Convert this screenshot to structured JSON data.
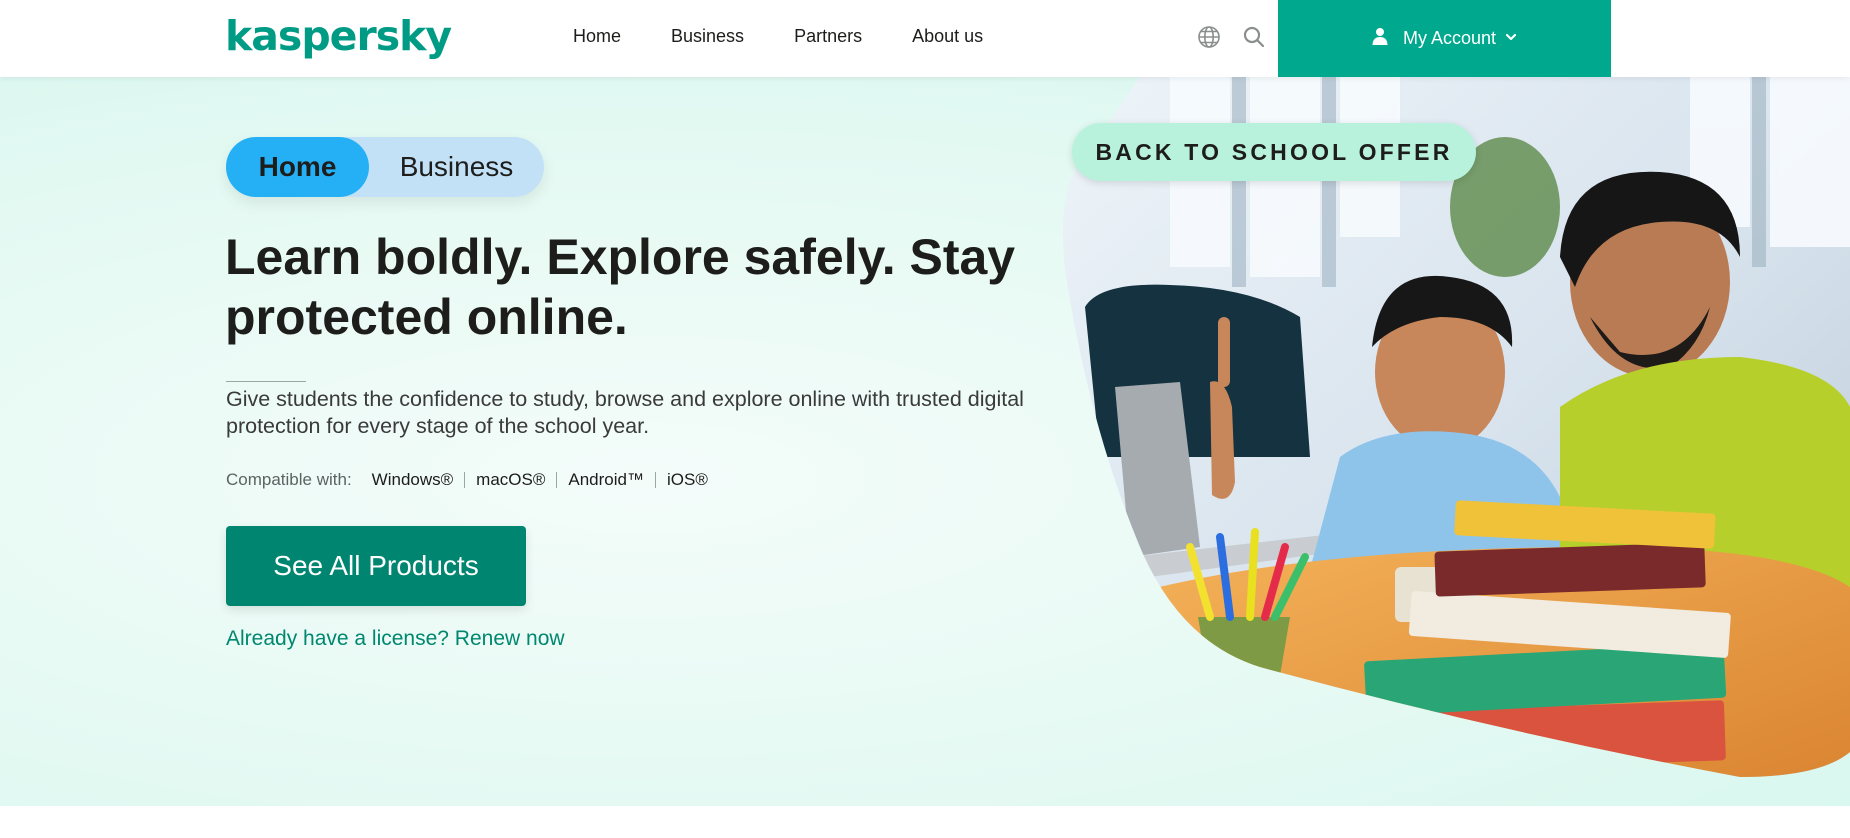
{
  "header": {
    "logo": "kaspersky",
    "nav": [
      {
        "label": "Home"
      },
      {
        "label": "Business"
      },
      {
        "label": "Partners"
      },
      {
        "label": "About us"
      }
    ],
    "icons": {
      "language": "globe-icon",
      "search": "search-icon"
    },
    "account_label": "My Account"
  },
  "hero": {
    "toggle": {
      "home": "Home",
      "business": "Business"
    },
    "headline": "Learn boldly. Explore safely. Stay protected online.",
    "description": "Give students the confidence to study, browse and explore online with trusted digital protection for every stage of the school year.",
    "compatible_label": "Compatible with:",
    "platforms": [
      "Windows®",
      "macOS®",
      "Android™",
      "iOS®"
    ],
    "cta_label": "See All Products",
    "renew_link": "Already have a license? Renew now",
    "badge": "BACK TO SCHOOL OFFER"
  },
  "colors": {
    "brand": "#00a88e",
    "cta": "#008571",
    "toggle_active": "#25b0f5",
    "toggle_bg": "#c3e1f6",
    "badge_bg": "#b9f2dc",
    "text": "#1d1d1b"
  }
}
